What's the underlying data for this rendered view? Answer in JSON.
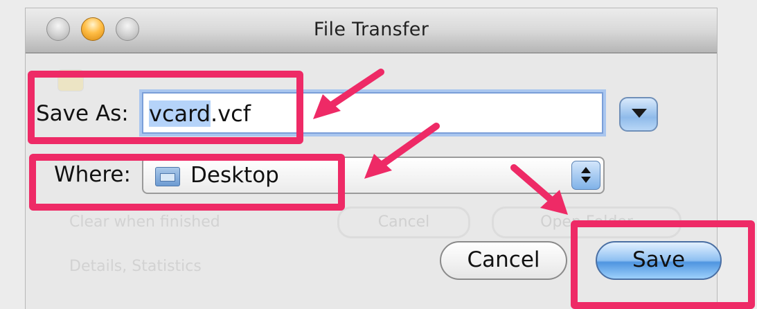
{
  "window": {
    "title": "File Transfer",
    "controls": {
      "close": "close-button",
      "minimize": "minimize-button",
      "zoom": "zoom-button"
    }
  },
  "form": {
    "save_as_label": "Save As:",
    "save_as_value_selected": "vcard",
    "save_as_value_ext": ".vcf",
    "where_label": "Where:",
    "where_value": "Desktop"
  },
  "buttons": {
    "cancel": "Cancel",
    "save": "Save"
  },
  "background_ghost": {
    "clear_when_finished": "Clear when finished",
    "cancel": "Cancel",
    "open_folder": "Open Folder",
    "details": "Details, Statistics"
  },
  "annotation": {
    "highlight_color": "#ee2a66"
  }
}
